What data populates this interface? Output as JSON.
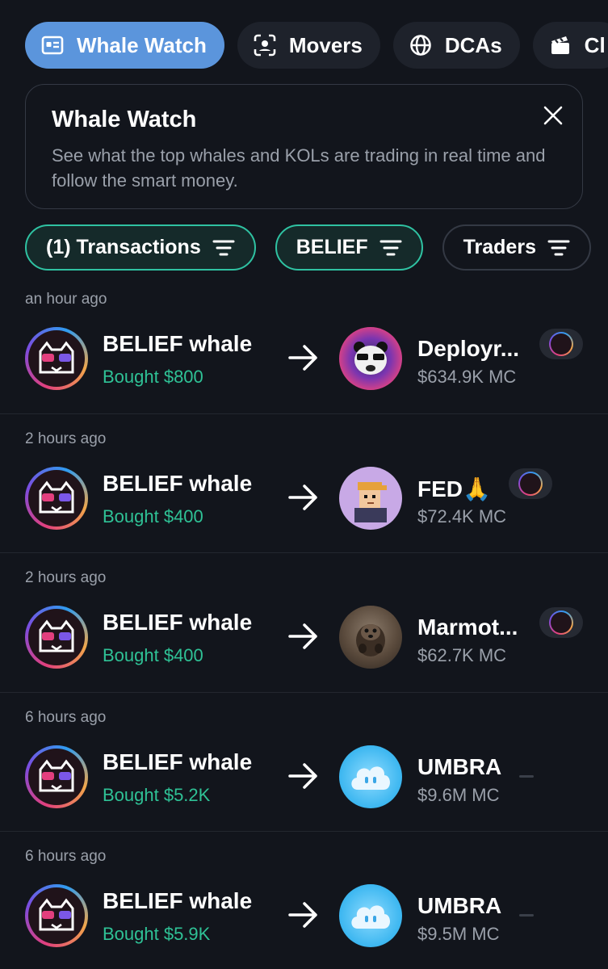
{
  "tabs": [
    {
      "label": "Whale Watch",
      "icon": "newspaper-icon",
      "active": true
    },
    {
      "label": "Movers",
      "icon": "scan-face-icon",
      "active": false
    },
    {
      "label": "DCAs",
      "icon": "globe-icon",
      "active": false
    },
    {
      "label": "Cl",
      "icon": "clapperboard-icon",
      "active": false
    }
  ],
  "card": {
    "title": "Whale Watch",
    "description": "See what the top whales and KOLs are trading in real time and follow the smart money."
  },
  "filters": [
    {
      "label": "(1) Transactions",
      "active": true
    },
    {
      "label": "BELIEF",
      "active": true
    },
    {
      "label": "Traders",
      "active": false
    }
  ],
  "feed": [
    {
      "time": "an hour ago",
      "whale": "BELIEF whale",
      "action": "Bought $800",
      "token": "Deployr...",
      "mcap": "$634.9K MC",
      "badge": "kol-avatar-badge"
    },
    {
      "time": "2 hours ago",
      "whale": "BELIEF whale",
      "action": "Bought $400",
      "token": "FED🙏",
      "mcap": "$72.4K MC",
      "badge": "kol-avatar-badge"
    },
    {
      "time": "2 hours ago",
      "whale": "BELIEF whale",
      "action": "Bought $400",
      "token": "Marmot...",
      "mcap": "$62.7K MC",
      "badge": "kol-avatar-badge"
    },
    {
      "time": "6 hours ago",
      "whale": "BELIEF whale",
      "action": "Bought $5.2K",
      "token": "UMBRA",
      "mcap": "$9.6M MC",
      "badge": "dash"
    },
    {
      "time": "6 hours ago",
      "whale": "BELIEF whale",
      "action": "Bought $5.9K",
      "token": "UMBRA",
      "mcap": "$9.5M MC",
      "badge": "dash"
    }
  ],
  "colors": {
    "background": "#12151c",
    "accent_tab": "#5b95dc",
    "positive": "#2fc296",
    "filter_active_border": "#2fc2a2",
    "muted_text": "#9aa0aa"
  }
}
